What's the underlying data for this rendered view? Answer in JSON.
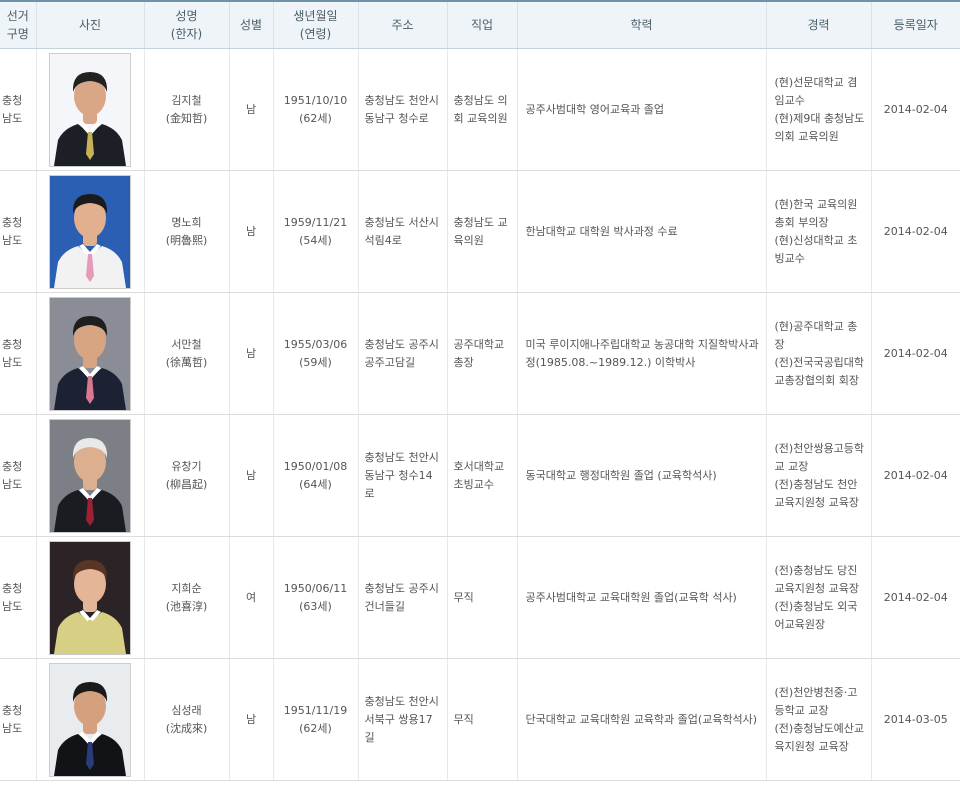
{
  "headers": [
    "선거\n구명",
    "사진",
    "성명\n(한자)",
    "성별",
    "생년월일\n(연령)",
    "주소",
    "직업",
    "학력",
    "경력",
    "등록일자"
  ],
  "rows": [
    {
      "region": "충청\n남도",
      "photo_bg": "#f4f6fa",
      "suit": "#1d1f26",
      "tie": "#c9b254",
      "face": "#d9a785",
      "hair": "#222222",
      "name": "김지철",
      "hanja": "(金知哲)",
      "gender": "남",
      "birth": "1951/10/10",
      "age": "(62세)",
      "address": "충청남도 천안시 동남구 청수로",
      "job": "충청남도 의회 교육의원",
      "education": "공주사범대학 영어교육과 졸업",
      "career": "(현)선문대학교 겸임교수\n(현)제9대 충청남도의회 교육의원",
      "date": "2014-02-04"
    },
    {
      "region": "충청\n남도",
      "photo_bg": "#2a5fb4",
      "suit": "#f2f2f2",
      "tie": "#e49ab8",
      "face": "#e2b08e",
      "hair": "#1b1b1b",
      "name": "명노희",
      "hanja": "(明魯熙)",
      "gender": "남",
      "birth": "1959/11/21",
      "age": "(54세)",
      "address": "충청남도 서산시 석림4로",
      "job": "충청남도 교육의원",
      "education": "한남대학교 대학원 박사과정 수료",
      "career": "(현)한국 교육의원 총회 부의장\n(현)신성대학교 초빙교수",
      "date": "2014-02-04"
    },
    {
      "region": "충청\n남도",
      "photo_bg": "#8a8d96",
      "suit": "#1c2233",
      "tie": "#d9788f",
      "face": "#d8a583",
      "hair": "#1f1f1f",
      "name": "서만철",
      "hanja": "(徐萬哲)",
      "gender": "남",
      "birth": "1955/03/06",
      "age": "(59세)",
      "address": "충청남도 공주시 공주고담길",
      "job": "공주대학교 총장",
      "education": "미국 루이지애나주립대학교 농공대학 지질학박사과정(1985.08.~1989.12.) 이학박사",
      "career": "(현)공주대학교 총장\n(전)전국국공립대학교총장협의회 회장",
      "date": "2014-02-04"
    },
    {
      "region": "충청\n남도",
      "photo_bg": "#7d7f86",
      "suit": "#1b1c22",
      "tie": "#9c2233",
      "face": "#dcb08f",
      "hair": "#e9e9e9",
      "name": "유창기",
      "hanja": "(柳昌起)",
      "gender": "남",
      "birth": "1950/01/08",
      "age": "(64세)",
      "address": "충청남도 천안시 동남구 청수14로",
      "job": "호서대학교 초빙교수",
      "education": "동국대학교 행정대학원 졸업 (교육학석사)",
      "career": "(전)천안쌍용고등학교 교장\n(전)충청남도 천안교육지원청 교육장",
      "date": "2014-02-04"
    },
    {
      "region": "충청\n남도",
      "photo_bg": "#2b2326",
      "suit": "#d7cf84",
      "tie": "#d7cf84",
      "face": "#e4b596",
      "hair": "#5a3424",
      "name": "지희순",
      "hanja": "(池喜淳)",
      "gender": "여",
      "birth": "1950/06/11",
      "age": "(63세)",
      "address": "충청남도 공주시 건너들길",
      "job": "무직",
      "education": "공주사범대학교 교육대학원 졸업(교육학 석사)",
      "career": "(전)충청남도 당진교육지원청 교육장\n(전)충청남도 외국어교육원장",
      "date": "2014-02-04"
    },
    {
      "region": "충청\n남도",
      "photo_bg": "#e9ecef",
      "suit": "#121317",
      "tie": "#2a3c7a",
      "face": "#d4a07e",
      "hair": "#1a1a1a",
      "name": "심성래",
      "hanja": "(沈成來)",
      "gender": "남",
      "birth": "1951/11/19",
      "age": "(62세)",
      "address": "충청남도 천안시 서북구 쌍용17길",
      "job": "무직",
      "education": "단국대학교 교육대학원 교육학과 졸업(교육학석사)",
      "career": "(전)천안병천중·고등학교 교장\n(전)충청남도예산교육지원청 교육장",
      "date": "2014-03-05"
    }
  ]
}
